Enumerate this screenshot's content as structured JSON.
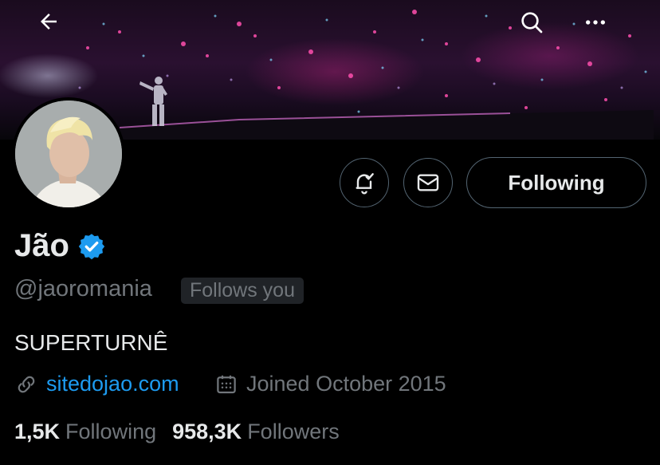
{
  "header": {
    "back_icon": "arrow-left-icon",
    "search_icon": "search-icon",
    "more_icon": "more-horizontal-icon"
  },
  "profile": {
    "name": "Jão",
    "verified_icon": "verified-badge-icon",
    "handle": "@jaoromania",
    "follows_you": "Follows you",
    "bio": "SUPERTURNÊ",
    "website": "sitedojao.com",
    "joined": "Joined October 2015",
    "following_count": "1,5K",
    "following_label": "Following",
    "followers_count": "958,3K",
    "followers_label": "Followers"
  },
  "actions": {
    "notifications_icon": "bell-check-icon",
    "message_icon": "envelope-icon",
    "follow_button": "Following"
  },
  "colors": {
    "background": "#000000",
    "text": "#e7e9ea",
    "muted": "#71767b",
    "accent": "#1d9bf0",
    "border": "#536471"
  }
}
